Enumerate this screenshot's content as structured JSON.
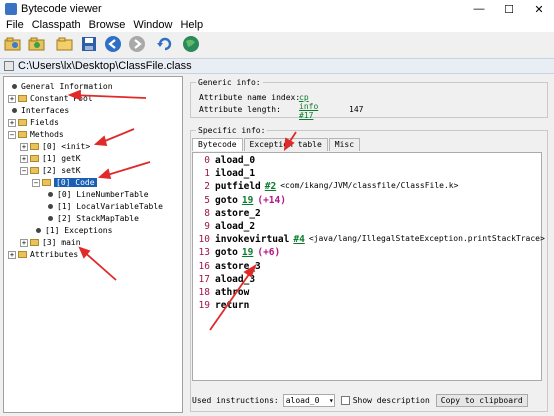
{
  "window": {
    "title": "Bytecode viewer",
    "minimize": "—",
    "maximize": "☐",
    "close": "✕"
  },
  "menu": [
    "File",
    "Classpath",
    "Browse",
    "Window",
    "Help"
  ],
  "toolbar": [
    "open-icon",
    "open-classpath-icon",
    "open-folder-icon",
    "save-icon",
    "back-icon",
    "forward-icon",
    "refresh-icon",
    "browser-icon"
  ],
  "path": "C:\\Users\\lx\\Desktop\\ClassFile.class",
  "tree": {
    "general": "General Information",
    "constant_pool": "Constant Pool",
    "interfaces": "Interfaces",
    "fields": "Fields",
    "methods": "Methods",
    "m0": "[0] <init>",
    "m1": "[1] getK",
    "m2": "[2] setK",
    "code": "[0] Code",
    "lnt": "[0] LineNumberTable",
    "lvt": "[1] LocalVariableTable",
    "smt": "[2] StackMapTable",
    "exc": "[1] Exceptions",
    "m3": "[3] main",
    "attributes": "Attributes"
  },
  "generic": {
    "legend": "Generic info:",
    "name_label": "Attribute name index:",
    "name_value": "cp info #17",
    "name_num": "",
    "len_label": "Attribute length:",
    "len_value": "147"
  },
  "specific": {
    "legend": "Specific info:"
  },
  "tabs": [
    "Bytecode",
    "Exception table",
    "Misc"
  ],
  "bytecode": [
    {
      "n": "0",
      "op": "aload_0",
      "arg": "",
      "cmt": "",
      "off": ""
    },
    {
      "n": "1",
      "op": "iload_1",
      "arg": "",
      "cmt": "",
      "off": ""
    },
    {
      "n": "2",
      "op": "putfield",
      "arg": "#2",
      "cmt": "<com/ikang/JVM/classfile/ClassFile.k>",
      "off": ""
    },
    {
      "n": "5",
      "op": "goto",
      "arg": "19",
      "cmt": "",
      "off": "(+14)"
    },
    {
      "n": "8",
      "op": "astore_2",
      "arg": "",
      "cmt": "",
      "off": ""
    },
    {
      "n": "9",
      "op": "aload_2",
      "arg": "",
      "cmt": "",
      "off": ""
    },
    {
      "n": "10",
      "op": "invokevirtual",
      "arg": "#4",
      "cmt": "<java/lang/IllegalStateException.printStackTrace>",
      "off": ""
    },
    {
      "n": "13",
      "op": "goto",
      "arg": "19",
      "cmt": "",
      "off": "(+6)"
    },
    {
      "n": "16",
      "op": "astore_3",
      "arg": "",
      "cmt": "",
      "off": ""
    },
    {
      "n": "17",
      "op": "aload_3",
      "arg": "",
      "cmt": "",
      "off": ""
    },
    {
      "n": "18",
      "op": "athrow",
      "arg": "",
      "cmt": "",
      "off": ""
    },
    {
      "n": "19",
      "op": "return",
      "arg": "",
      "cmt": "",
      "off": ""
    }
  ],
  "bottom": {
    "used_label": "Used instructions:",
    "used_value": "aload_0",
    "show_desc": "Show description",
    "copy": "Copy to clipboard"
  },
  "colors": {
    "selection": "#1a5fb4",
    "annotation": "#e02a2a",
    "link": "#0a7d2c",
    "offset": "#b0158a",
    "linenum": "#a0144e"
  }
}
